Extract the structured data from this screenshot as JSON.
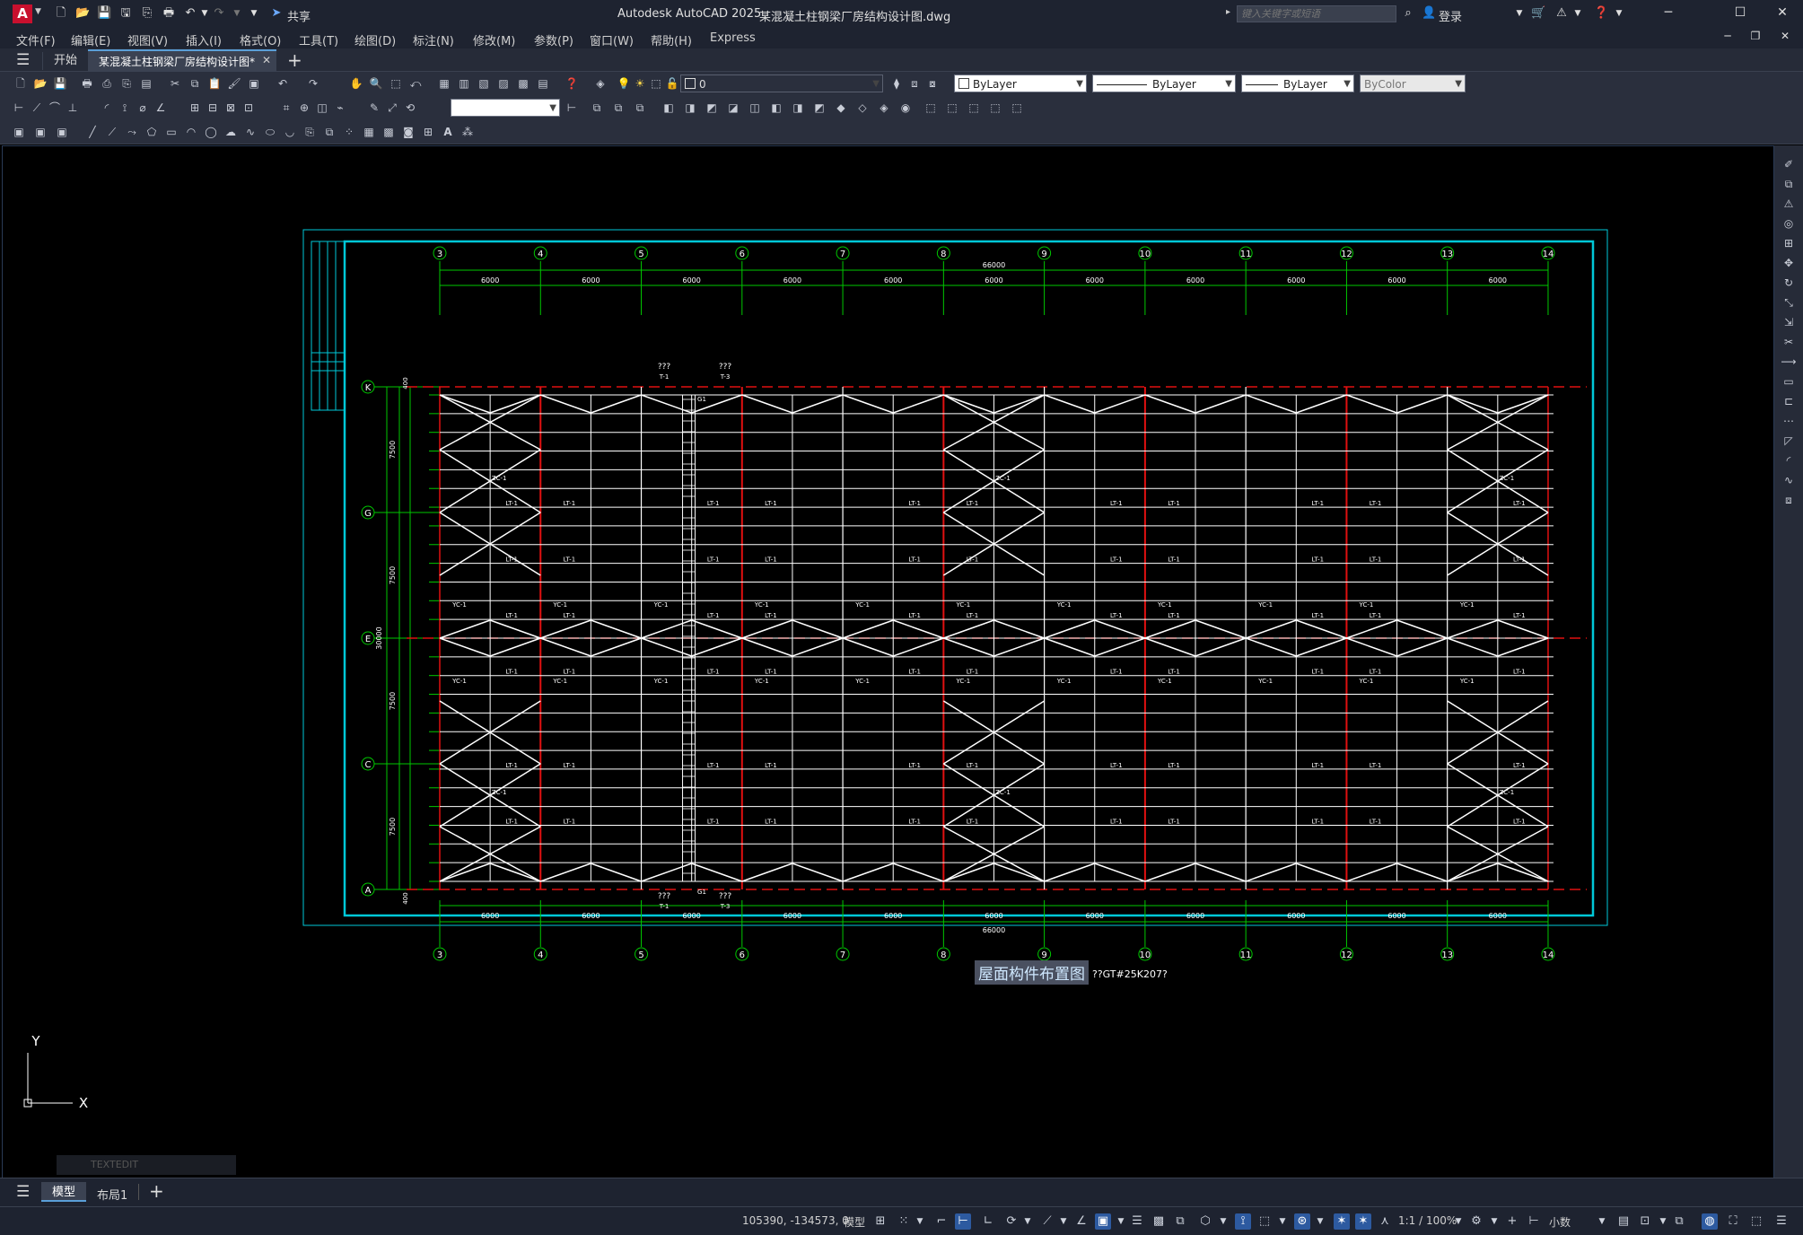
{
  "app": {
    "logo": "A",
    "share_label": "共享",
    "title": "Autodesk AutoCAD 2025",
    "doc_title": "某混凝土柱钢梁厂房结构设计图.dwg",
    "search_placeholder": "键入关键字或短语",
    "login_label": "登录"
  },
  "menu": [
    "文件(F)",
    "编辑(E)",
    "视图(V)",
    "插入(I)",
    "格式(O)",
    "工具(T)",
    "绘图(D)",
    "标注(N)",
    "修改(M)",
    "参数(P)",
    "窗口(W)",
    "帮助(H)",
    "Express"
  ],
  "tabs": [
    {
      "label": "开始",
      "active": false
    },
    {
      "label": "某混凝土柱钢梁厂房结构设计图*",
      "active": true
    }
  ],
  "toolbar": {
    "layer_value": "0",
    "color_value": "ByLayer",
    "linetype_value": "ByLayer",
    "lineweight_value": "ByLayer",
    "plotstyle_value": "ByColor",
    "textstyle_value": ""
  },
  "drawing": {
    "top_dim_total": "66000",
    "bottom_dim_total": "66000",
    "column_labels": [
      "3",
      "4",
      "5",
      "6",
      "7",
      "8",
      "9",
      "10",
      "11",
      "12",
      "13",
      "14"
    ],
    "bay_dims": [
      "6000",
      "6000",
      "6000",
      "6000",
      "6000",
      "6000",
      "6000",
      "6000",
      "6000",
      "6000",
      "6000"
    ],
    "row_labels": [
      "K",
      "G",
      "E",
      "C",
      "A"
    ],
    "row_dims": [
      "7500",
      "7500",
      "7500",
      "7500"
    ],
    "overall_height_dim": "30000",
    "edge_dim": "400",
    "purlin_label": "LT-1",
    "brace_label": "YC-1",
    "tie_label": "ZC-1",
    "top_note_1": "???",
    "top_note_1b": "T-1",
    "top_note_2": "???",
    "top_note_2b": "T-3",
    "bottom_note_1": "???",
    "bottom_note_1b": "T-1",
    "bottom_note_2": "???",
    "bottom_note_2b": "T-3",
    "gutter_label": "G1",
    "plan_title": "屋面构件布置图",
    "plan_subtitle": "??GT#25K207?",
    "ucs_x": "X",
    "ucs_y": "Y",
    "command_text": "TEXTEDIT"
  },
  "layouts": [
    {
      "label": "模型",
      "active": true
    },
    {
      "label": "布局1",
      "active": false
    }
  ],
  "status": {
    "coords": "105390, -134573, 0",
    "model_label": "模型",
    "scale_label": "1:1 / 100%",
    "units_label": "小数"
  },
  "colors": {
    "cyan": "#00c8d8",
    "green": "#00c800",
    "red": "#e01010",
    "white": "#ffffff",
    "accent": "#2d5aa0"
  }
}
